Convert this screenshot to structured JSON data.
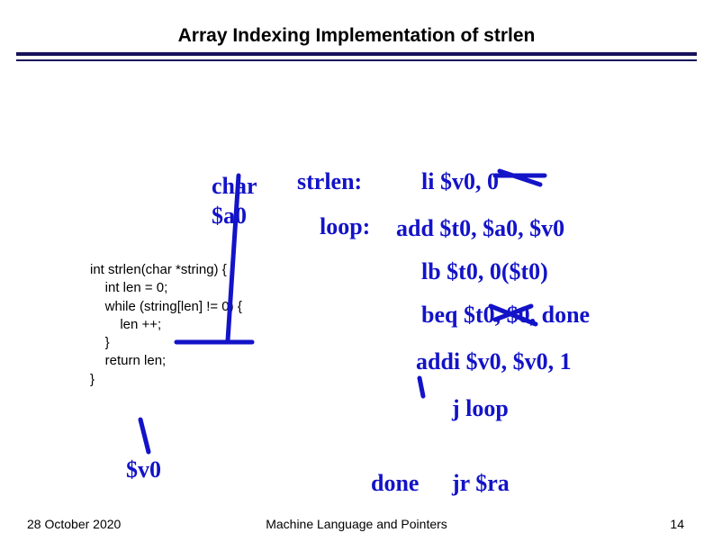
{
  "slide": {
    "title": "Array Indexing Implementation of strlen"
  },
  "code": {
    "line1": "int strlen(char *string) {",
    "line2": "    int len = 0;",
    "line3": "    while (string[len] != 0) {",
    "line4": "        len ++;",
    "line5": "    }",
    "line6": "    return len;",
    "line7": "}"
  },
  "footer": {
    "date": "28 October 2020",
    "center": "Machine Language and Pointers",
    "page": "14"
  },
  "annotations": {
    "var_annot_string": "$a0",
    "var_annot_len": "$v0",
    "var_annot_type": "char",
    "asm_label_1": "strlen:",
    "asm_label_2": "loop:",
    "asm_label_3": "done",
    "asm_line_1": "li   $v0, 0",
    "asm_line_2": "add  $t0, $a0, $v0",
    "asm_line_3": "lb   $t0, 0($t0)",
    "asm_line_4": "beq  $t0, $0, done",
    "asm_line_5": "addi $v0, $v0, 1",
    "asm_line_6": "j    loop",
    "asm_line_7": "jr   $ra"
  }
}
